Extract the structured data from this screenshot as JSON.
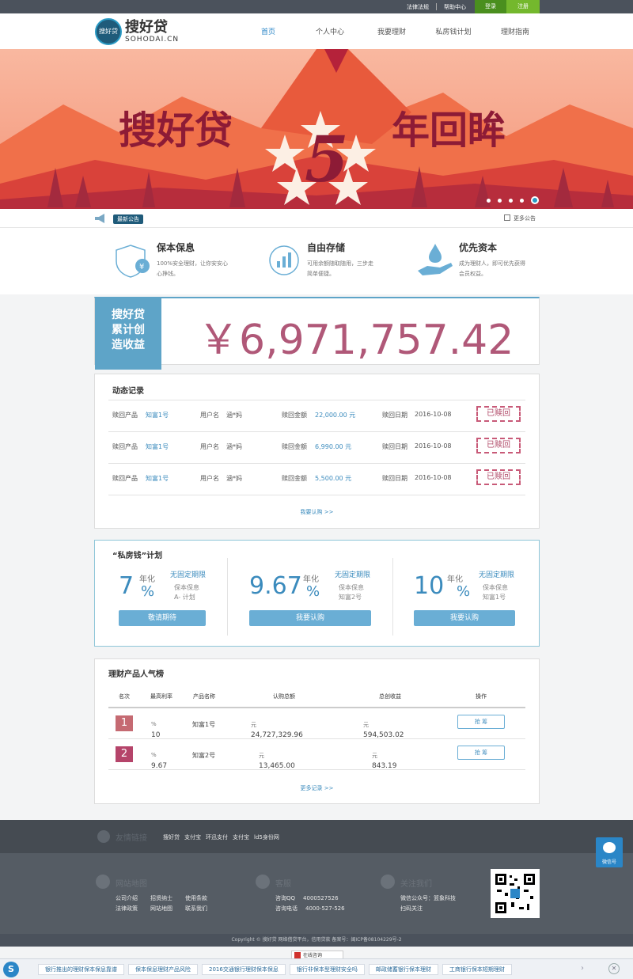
{
  "topbar": {
    "legal": "法律法规",
    "help": "帮助中心",
    "login": "登录",
    "register": "注册"
  },
  "header": {
    "logo_cn": "搜好贷",
    "logo_en": "SOHODAI.CN",
    "logo_mark": "搜好贷"
  },
  "nav": [
    "首页",
    "个人中心",
    "我要理财",
    "私房钱计划",
    "理财指南"
  ],
  "banner": {
    "left_title": "搜好贷",
    "number": "5",
    "right_title": "年回眸"
  },
  "notice": {
    "tag": "最新公告",
    "more": "更多公告"
  },
  "features": [
    {
      "title": "保本保息",
      "desc": "100%安全理财，让你安安心心挣钱。"
    },
    {
      "title": "自由存储",
      "desc": "可用余额随取随用，三步走简单便捷。"
    },
    {
      "title": "优先资本",
      "desc": "成为理财人，即可优先获得会员权益。"
    }
  ],
  "total": {
    "badge_l1": "搜好贷",
    "badge_l2": "累计创",
    "badge_l3": "造收益",
    "amount": "￥6,971,757.42"
  },
  "records": {
    "title": "动态记录",
    "labels": {
      "product": "赎回产品",
      "user": "用户名",
      "amount": "赎回金额",
      "date": "赎回日期"
    },
    "stamp": "已赎回",
    "rows": [
      {
        "product": "知富1号",
        "user": "涵*妈",
        "amount": "22,000.00 元",
        "date": "2016-10-08"
      },
      {
        "product": "知富1号",
        "user": "涵*妈",
        "amount": "6,990.00 元",
        "date": "2016-10-08"
      },
      {
        "product": "知富1号",
        "user": "涵*妈",
        "amount": "5,500.00 元",
        "date": "2016-10-08"
      }
    ],
    "more": "我要认购 >>"
  },
  "plan": {
    "title": "“私房钱”计划",
    "annual": "年化",
    "term": "无固定期限",
    "items": [
      {
        "rate": "7",
        "pct": "%",
        "s1": "保本保息",
        "s2": "A- 计划",
        "button": "敬请期待"
      },
      {
        "rate": "9.67",
        "pct": "%",
        "s1": "保本保息",
        "s2": "知富2号",
        "button": "我要认购"
      },
      {
        "rate": "10",
        "pct": "%",
        "s1": "保本保息",
        "s2": "知富1号",
        "button": "我要认购"
      }
    ]
  },
  "rank": {
    "title": "理财产品人气榜",
    "headers": [
      "名次",
      "最高利率",
      "产品名称",
      "认购总额",
      "总创收益",
      "操作"
    ],
    "rows": [
      {
        "no": "1",
        "rate": "10",
        "unit": "%",
        "name": "知富1号",
        "total": "24,727,329.96",
        "total_unit": "元",
        "earn": "594,503.02",
        "earn_unit": "元",
        "action": "抢 筹",
        "color": "#c56a72"
      },
      {
        "no": "2",
        "rate": "9.67",
        "unit": "%",
        "name": "知富2号",
        "total": "13,465.00",
        "total_unit": "元",
        "earn": "843.19",
        "earn_unit": "元",
        "action": "抢 筹",
        "color": "#b5446a"
      }
    ],
    "more": "更多记录 >>"
  },
  "footer": {
    "friend_label": "友情链接",
    "friend_links": [
      "搜好贷",
      "支付宝",
      "环迅支付",
      "支付宝",
      "ld5身份网"
    ],
    "col1": {
      "head": "网站地图",
      "rows": [
        [
          "公司介绍",
          "招贤纳士",
          "使用条款"
        ],
        [
          "法律政策",
          "网站地图",
          "联系我们"
        ]
      ]
    },
    "col2": {
      "head": "客服",
      "rows": [
        [
          "咨询QQ",
          "4000527526"
        ],
        [
          "咨询电话",
          "4000-527-526"
        ]
      ]
    },
    "col3": {
      "head": "关注我们",
      "rows": [
        "微信公众号：篮象科技",
        "扫码关注"
      ]
    },
    "copyright": "Copyright © 搜好贷 网络借贷平台，信用贷款  备案号：闽ICP备08104229号-2"
  },
  "wechat": "微信号",
  "redtab": "在线咨询",
  "bottombar": {
    "items": [
      "银行推出的理财保本保息靠谱",
      "保本保息理财产品风险",
      "2016交通银行理财保本保息",
      "银行非保本型理财安全吗",
      "邮政储蓄银行保本理财",
      "工商银行保本短期理财"
    ],
    "close": "✕",
    "arrow": "›"
  }
}
